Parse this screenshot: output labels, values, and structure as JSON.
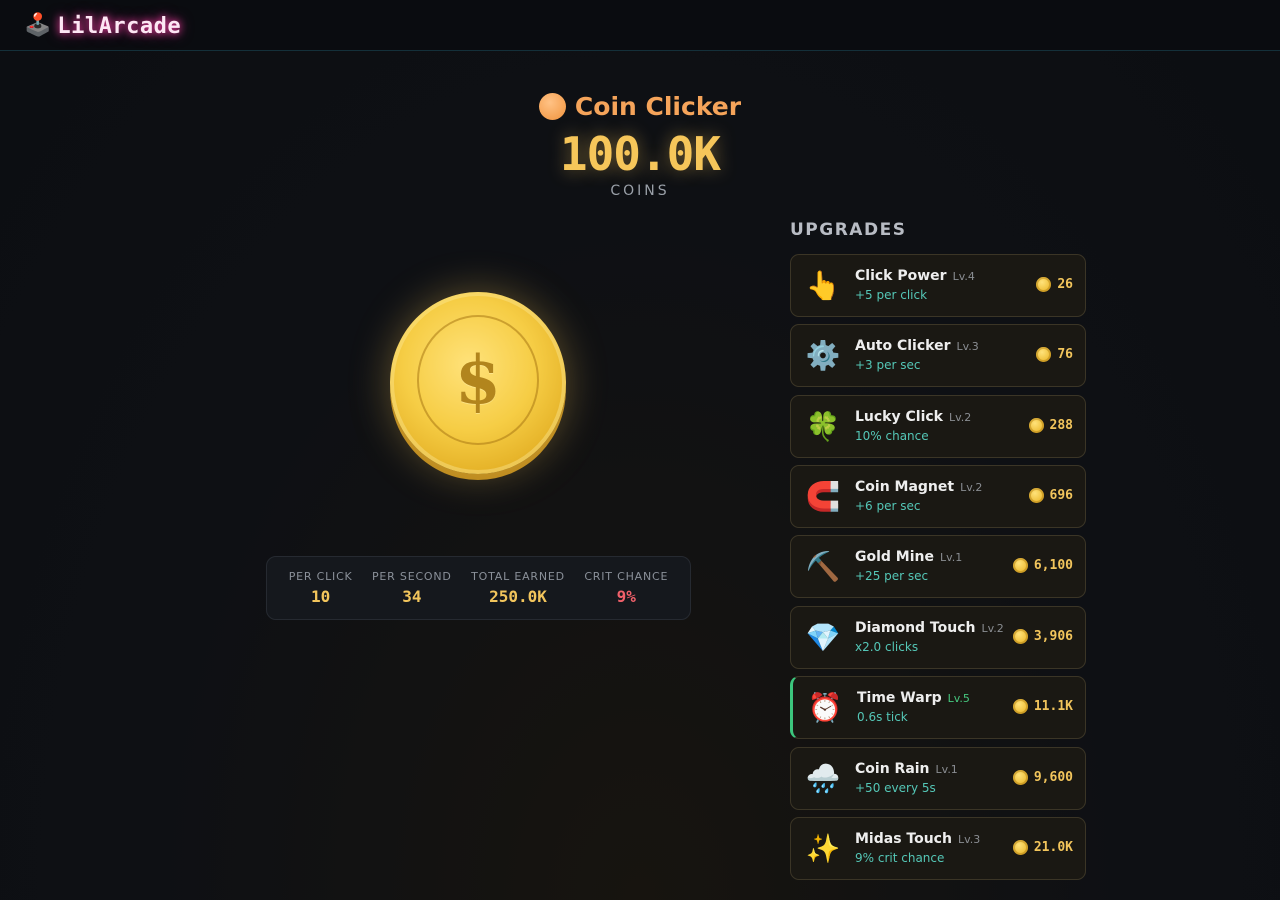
{
  "nav": {
    "logo_icon": "🕹️",
    "logo_text": "LilArcade"
  },
  "game": {
    "title": "Coin Clicker",
    "title_icon": "orange-coin-icon",
    "coins": "100.0K",
    "coins_label": "COINS",
    "coin_symbol": "$"
  },
  "stats": [
    {
      "label": "PER CLICK",
      "value": "10"
    },
    {
      "label": "PER SECOND",
      "value": "34"
    },
    {
      "label": "TOTAL EARNED",
      "value": "250.0K"
    },
    {
      "label": "CRIT CHANCE",
      "value": "9%"
    }
  ],
  "upgrades_title": "UPGRADES",
  "upgrades": [
    {
      "icon": "👆",
      "name": "Click Power",
      "level": "Lv.4",
      "desc": "+5 per click",
      "price": "26"
    },
    {
      "icon": "⚙️",
      "name": "Auto Clicker",
      "level": "Lv.3",
      "desc": "+3 per sec",
      "price": "76"
    },
    {
      "icon": "🍀",
      "name": "Lucky Click",
      "level": "Lv.2",
      "desc": "10% chance",
      "price": "288"
    },
    {
      "icon": "🧲",
      "name": "Coin Magnet",
      "level": "Lv.2",
      "desc": "+6 per sec",
      "price": "696"
    },
    {
      "icon": "⛏️",
      "name": "Gold Mine",
      "level": "Lv.1",
      "desc": "+25 per sec",
      "price": "6,100"
    },
    {
      "icon": "💎",
      "name": "Diamond Touch",
      "level": "Lv.2",
      "desc": "x2.0 clicks",
      "price": "3,906"
    },
    {
      "icon": "⏰",
      "name": "Time Warp",
      "level": "Lv.5",
      "desc": "0.6s tick",
      "price": "11.1K"
    },
    {
      "icon": "🌧️",
      "name": "Coin Rain",
      "level": "Lv.1",
      "desc": "+50 every 5s",
      "price": "9,600"
    },
    {
      "icon": "✨",
      "name": "Midas Touch",
      "level": "Lv.3",
      "desc": "9% crit chance",
      "price": "21.0K"
    }
  ],
  "colors": {
    "accent": "#f2c55c",
    "title": "#f5a45a",
    "crit": "#f0606a",
    "active": "#3cc67d",
    "desc": "#54c6b6"
  }
}
